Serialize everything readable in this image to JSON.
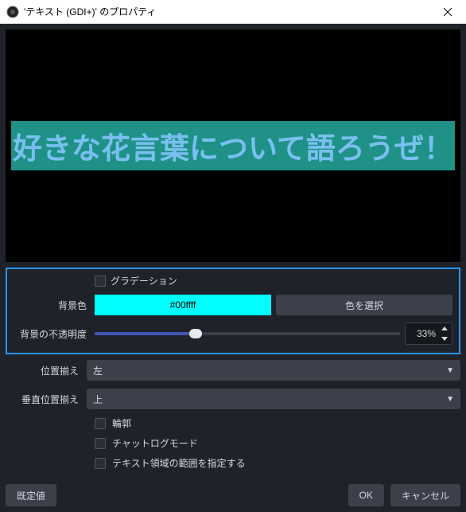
{
  "window": {
    "title": "'テキスト (GDI+)' のプロパティ"
  },
  "preview": {
    "text": "好きな花言葉について語ろうぜ！"
  },
  "truncated_checkbox": {
    "label": "グラデーション"
  },
  "bg_color": {
    "label": "背景色",
    "hex": "#00ffff",
    "button": "色を選択"
  },
  "bg_opacity": {
    "label": "背景の不透明度",
    "value": "33%",
    "percent": 33
  },
  "align": {
    "label": "位置揃え",
    "value": "左"
  },
  "valign": {
    "label": "垂直位置揃え",
    "value": "上"
  },
  "checks": {
    "outline": "輪郭",
    "chatlog": "チャットログモード",
    "extent": "テキスト領域の範囲を指定する"
  },
  "footer": {
    "defaults": "既定値",
    "ok": "OK",
    "cancel": "キャンセル"
  }
}
